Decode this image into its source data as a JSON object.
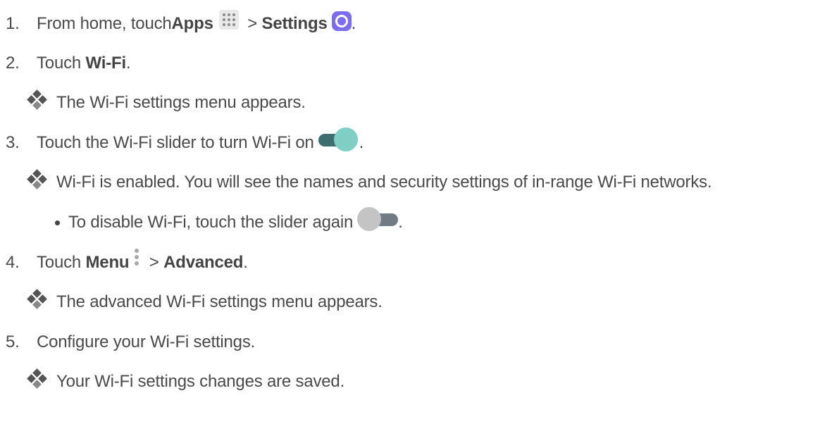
{
  "steps": [
    {
      "number": "1.",
      "text_a": "From home, touch ",
      "bold_a": "Apps",
      "sep": " > ",
      "bold_b": "Settings",
      "end": "."
    },
    {
      "number": "2.",
      "text_a": "Touch ",
      "bold_a": "Wi-Fi",
      "end": "."
    },
    {
      "result": "The Wi-Fi settings menu appears."
    },
    {
      "number": "3.",
      "text_a": "Touch the Wi-Fi slider to turn Wi-Fi on",
      "end": "."
    },
    {
      "result": "Wi-Fi is enabled. You will see the names and security settings of in-range Wi-Fi networks."
    },
    {
      "bullet": "To disable Wi-Fi, touch the slider again",
      "end": "."
    },
    {
      "number": "4.",
      "text_a": "Touch ",
      "bold_a": "Menu",
      "sep": " > ",
      "bold_b": "Advanced",
      "end": "."
    },
    {
      "result": "The advanced Wi-Fi settings menu appears."
    },
    {
      "number": "5.",
      "text_a": "Configure your Wi-Fi settings."
    },
    {
      "result": "Your Wi-Fi settings changes are saved."
    }
  ],
  "icons": {
    "apps": "apps-grid-icon",
    "settings": "settings-gear-icon",
    "toggle_on": "toggle-on-icon",
    "toggle_off": "toggle-off-icon",
    "menu": "more-vertical-icon",
    "result_marker": "four-diamond-icon"
  },
  "colors": {
    "text": "#4a4a4a",
    "settings_icon": "#7b6cf0",
    "toggle_on_knob": "#7fcfc4",
    "toggle_on_track": "#3f6e70",
    "toggle_off_knob": "#c4c4c4",
    "toggle_off_track": "#727b84"
  }
}
